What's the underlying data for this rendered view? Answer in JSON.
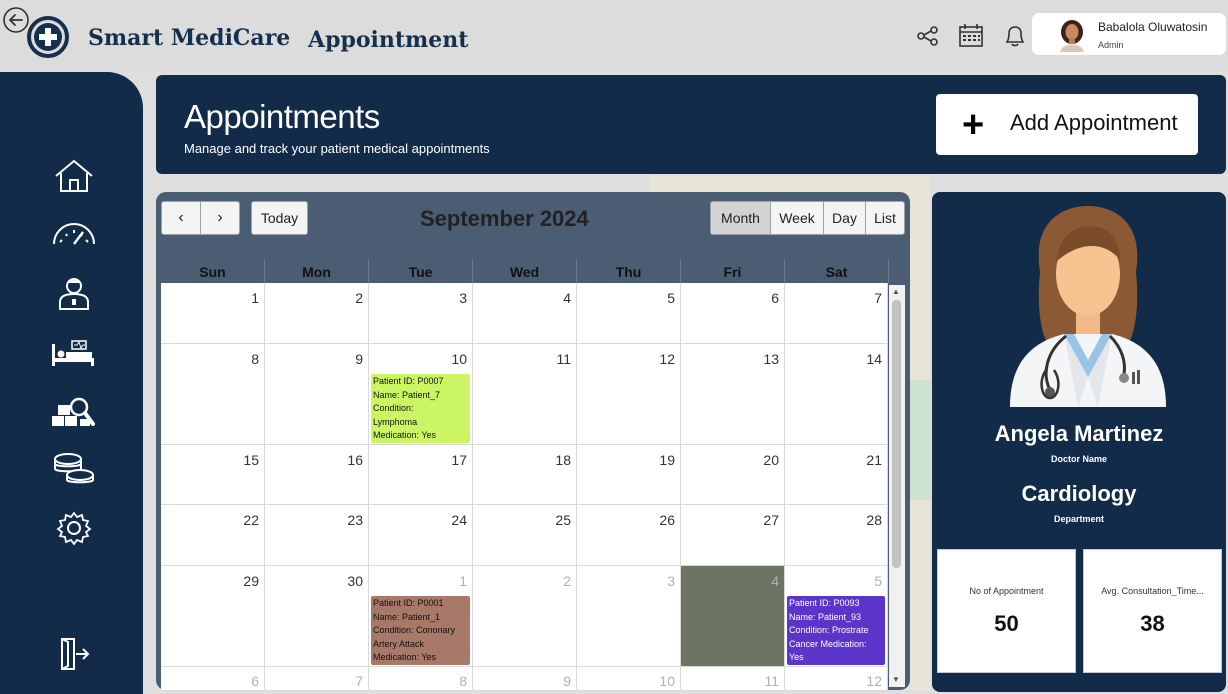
{
  "app": {
    "title": "Smart MediCare",
    "subtitle": "Appointment"
  },
  "user": {
    "name": "Babalola Oluwatosin",
    "role": "Admin"
  },
  "sidebar": {
    "items": [
      {
        "icon": "home-icon"
      },
      {
        "icon": "dashboard-gauge-icon"
      },
      {
        "icon": "doctor-icon"
      },
      {
        "icon": "hospital-bed-icon"
      },
      {
        "icon": "inventory-search-icon"
      },
      {
        "icon": "coins-icon"
      },
      {
        "icon": "gear-icon"
      }
    ],
    "bottom_icon": "logout-icon"
  },
  "header": {
    "title": "Appointments",
    "subtitle": "Manage and track your patient medical appointments",
    "add_button": {
      "plus": "+",
      "label": "Add Appointment"
    }
  },
  "calendar": {
    "prev": "‹",
    "next": "›",
    "today_label": "Today",
    "month_title": "September 2024",
    "views": [
      "Month",
      "Week",
      "Day",
      "List"
    ],
    "active_view": "Month",
    "weekdays": [
      "Sun",
      "Mon",
      "Tue",
      "Wed",
      "Thu",
      "Fri",
      "Sat"
    ],
    "weeks": [
      [
        {
          "d": "1"
        },
        {
          "d": "2"
        },
        {
          "d": "3"
        },
        {
          "d": "4"
        },
        {
          "d": "5"
        },
        {
          "d": "6"
        },
        {
          "d": "7"
        }
      ],
      [
        {
          "d": "8"
        },
        {
          "d": "9"
        },
        {
          "d": "10"
        },
        {
          "d": "11"
        },
        {
          "d": "12"
        },
        {
          "d": "13"
        },
        {
          "d": "14"
        }
      ],
      [
        {
          "d": "15"
        },
        {
          "d": "16"
        },
        {
          "d": "17"
        },
        {
          "d": "18"
        },
        {
          "d": "19"
        },
        {
          "d": "20"
        },
        {
          "d": "21"
        }
      ],
      [
        {
          "d": "22"
        },
        {
          "d": "23"
        },
        {
          "d": "24"
        },
        {
          "d": "25"
        },
        {
          "d": "26"
        },
        {
          "d": "27"
        },
        {
          "d": "28"
        }
      ],
      [
        {
          "d": "29"
        },
        {
          "d": "30"
        },
        {
          "d": "1",
          "other": true
        },
        {
          "d": "2",
          "other": true
        },
        {
          "d": "3",
          "other": true
        },
        {
          "d": "4",
          "other": true
        },
        {
          "d": "5",
          "other": true
        }
      ],
      [
        {
          "d": "6",
          "other": true
        },
        {
          "d": "7",
          "other": true
        },
        {
          "d": "8",
          "other": true
        },
        {
          "d": "9",
          "other": true
        },
        {
          "d": "10",
          "other": true
        },
        {
          "d": "11",
          "other": true
        },
        {
          "d": "12",
          "other": true
        }
      ]
    ],
    "events": [
      {
        "week": 1,
        "day": 2,
        "color": "#ccf563",
        "text_color": "#111111",
        "lines": [
          "Patient ID: P0007",
          "Name: Patient_7",
          "Condition:",
          "Lymphoma",
          "Medication: Yes"
        ]
      },
      {
        "week": 4,
        "day": 2,
        "color": "#a87868",
        "text_color": "#111111",
        "lines": [
          "Patient ID: P0001",
          "Name: Patient_1",
          "Condition: Cononary",
          "Artery Attack",
          "Medication: Yes"
        ]
      },
      {
        "week": 4,
        "day": 6,
        "color": "#5b34c9",
        "text_color": "#ffffff",
        "lines": [
          "Patient ID: P0093",
          "Name: Patient_93",
          "Condition: Prostrate",
          "Cancer Medication:",
          "Yes"
        ]
      }
    ],
    "highlight": {
      "week": 4,
      "day": 5,
      "color": "#6c7464"
    }
  },
  "doctor": {
    "name": "Angela Martinez",
    "name_label": "Doctor Name",
    "department": "Cardiology",
    "department_label": "Department"
  },
  "kpis": [
    {
      "label": "No of Appointment",
      "value": "50"
    },
    {
      "label": "Avg. Consultation_Time...",
      "value": "38"
    }
  ],
  "colors": {
    "navy": "#122b48",
    "calendar_header": "#4a5d73",
    "background": "#dedede"
  }
}
